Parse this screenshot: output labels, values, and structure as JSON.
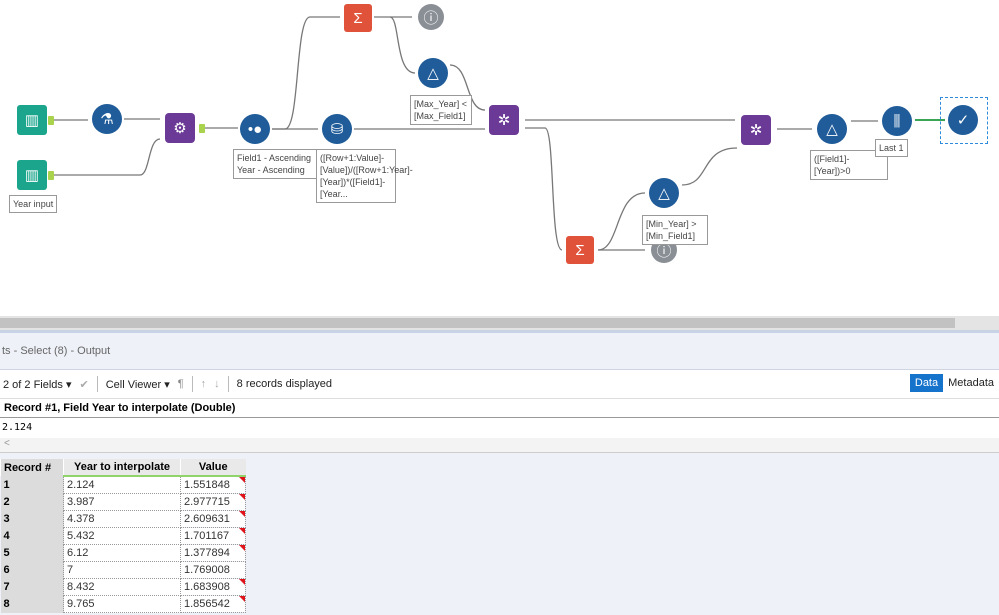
{
  "canvas": {
    "annotations": {
      "year_input": "Year input",
      "sort": "Field1 - Ascending Year - Ascending",
      "multirow": "([Row+1:Value]-[Value])/([Row+1:Year]-[Year])*([Field1]-[Year...",
      "filter_top": "[Max_Year] < [Max_Field1]",
      "filter_bottom": "[Min_Year] > [Min_Field1]",
      "filter_right": "([Field1]-[Year])>0",
      "sample": "Last 1"
    },
    "colors": {
      "input": "#1aa58c",
      "prep": "#1f5c99",
      "join": "#6b3a96",
      "transform": "#e0523a",
      "browse": "#8a8f96",
      "anchor": "#a9d34c"
    }
  },
  "results": {
    "title": "ts - Select (8) - Output",
    "fields_selector": "2 of 2 Fields",
    "cell_viewer": "Cell Viewer",
    "records_displayed": "8 records displayed",
    "tabs": [
      "Data",
      "Metadata"
    ],
    "record_header": "Record #1, Field Year to interpolate (Double)",
    "cell_value": "2.124",
    "columns": [
      "Record #",
      "Year to interpolate",
      "Value"
    ],
    "rows": [
      [
        "1",
        "2.124",
        "1.551848"
      ],
      [
        "2",
        "3.987",
        "2.977715"
      ],
      [
        "3",
        "4.378",
        "2.609631"
      ],
      [
        "4",
        "5.432",
        "1.701167"
      ],
      [
        "5",
        "6.12",
        "1.377894"
      ],
      [
        "6",
        "7",
        "1.769008"
      ],
      [
        "7",
        "8.432",
        "1.683908"
      ],
      [
        "8",
        "9.765",
        "1.856542"
      ]
    ]
  }
}
